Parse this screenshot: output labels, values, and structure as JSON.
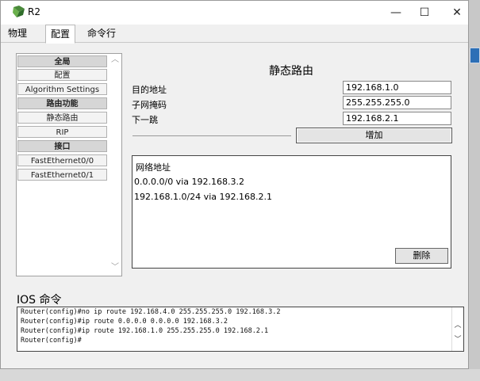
{
  "window": {
    "title": "R2",
    "min": "—",
    "max": "☐",
    "close": "✕"
  },
  "tabs": [
    {
      "label": "物理"
    },
    {
      "label": "配置"
    },
    {
      "label": "命令行"
    }
  ],
  "sidebar": {
    "items": [
      {
        "label": "全局",
        "header": true
      },
      {
        "label": "配置",
        "header": false
      },
      {
        "label": "Algorithm Settings",
        "header": false
      },
      {
        "label": "路由功能",
        "header": true
      },
      {
        "label": "静态路由",
        "header": false
      },
      {
        "label": "RIP",
        "header": false
      },
      {
        "label": "接口",
        "header": true
      },
      {
        "label": "FastEthernet0/0",
        "header": false
      },
      {
        "label": "FastEthernet0/1",
        "header": false
      }
    ]
  },
  "static_route": {
    "title": "静态路由",
    "dest_label": "目的地址",
    "dest_value": "192.168.1.0",
    "mask_label": "子网掩码",
    "mask_value": "255.255.255.0",
    "hop_label": "下一跳",
    "hop_value": "192.168.2.1",
    "add_label": "增加",
    "list_header": "网络地址",
    "routes": [
      "0.0.0.0/0 via 192.168.3.2",
      "192.168.1.0/24 via 192.168.2.1"
    ],
    "delete_label": "删除"
  },
  "ios": {
    "label": "IOS 命令",
    "lines": [
      "Router(config)#no ip route 192.168.4.0 255.255.255.0 192.168.3.2",
      "Router(config)#ip route 0.0.0.0 0.0.0.0 192.168.3.2",
      "Router(config)#ip route 192.168.1.0 255.255.255.0 192.168.2.1",
      "Router(config)#"
    ]
  }
}
